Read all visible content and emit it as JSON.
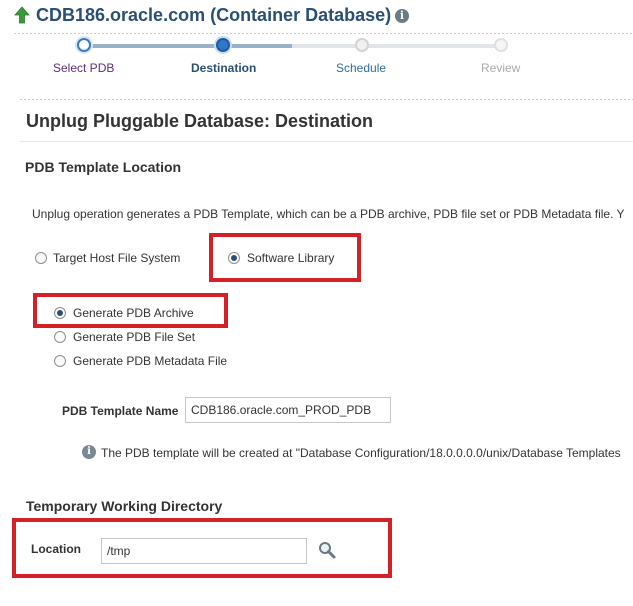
{
  "header": {
    "title": "CDB186.oracle.com (Container Database)",
    "back_icon": "up-arrow-icon",
    "info_icon": "info-icon"
  },
  "train": {
    "steps": [
      {
        "label": "Select PDB",
        "state": "visited"
      },
      {
        "label": "Destination",
        "state": "current"
      },
      {
        "label": "Schedule",
        "state": "unvisited"
      },
      {
        "label": "Review",
        "state": "disabled"
      }
    ]
  },
  "page": {
    "title": "Unplug Pluggable Database: Destination"
  },
  "template_location": {
    "section_title": "PDB Template Location",
    "description": "Unplug operation generates a PDB Template, which can be a PDB archive, PDB file set or PDB Metadata file. Y",
    "location_options": [
      {
        "label": "Target Host File System",
        "selected": false
      },
      {
        "label": "Software Library",
        "selected": true
      }
    ],
    "generate_options": [
      {
        "label": "Generate PDB Archive",
        "selected": true
      },
      {
        "label": "Generate PDB File Set",
        "selected": false
      },
      {
        "label": "Generate PDB Metadata File",
        "selected": false
      }
    ],
    "template_name_label": "PDB Template Name",
    "template_name_value": "CDB186.oracle.com_PROD_PDB",
    "info_text": "The PDB template will be created at \"Database Configuration/18.0.0.0.0/unix/Database Templates"
  },
  "working_directory": {
    "section_title": "Temporary Working Directory",
    "location_label": "Location",
    "location_value": "/tmp",
    "search_icon": "search-icon"
  },
  "colors": {
    "header_title": "#2a4f75",
    "highlight_border": "#d42027",
    "current_step": "#2f77c9",
    "visited_step_label": "#5b2d7e"
  }
}
